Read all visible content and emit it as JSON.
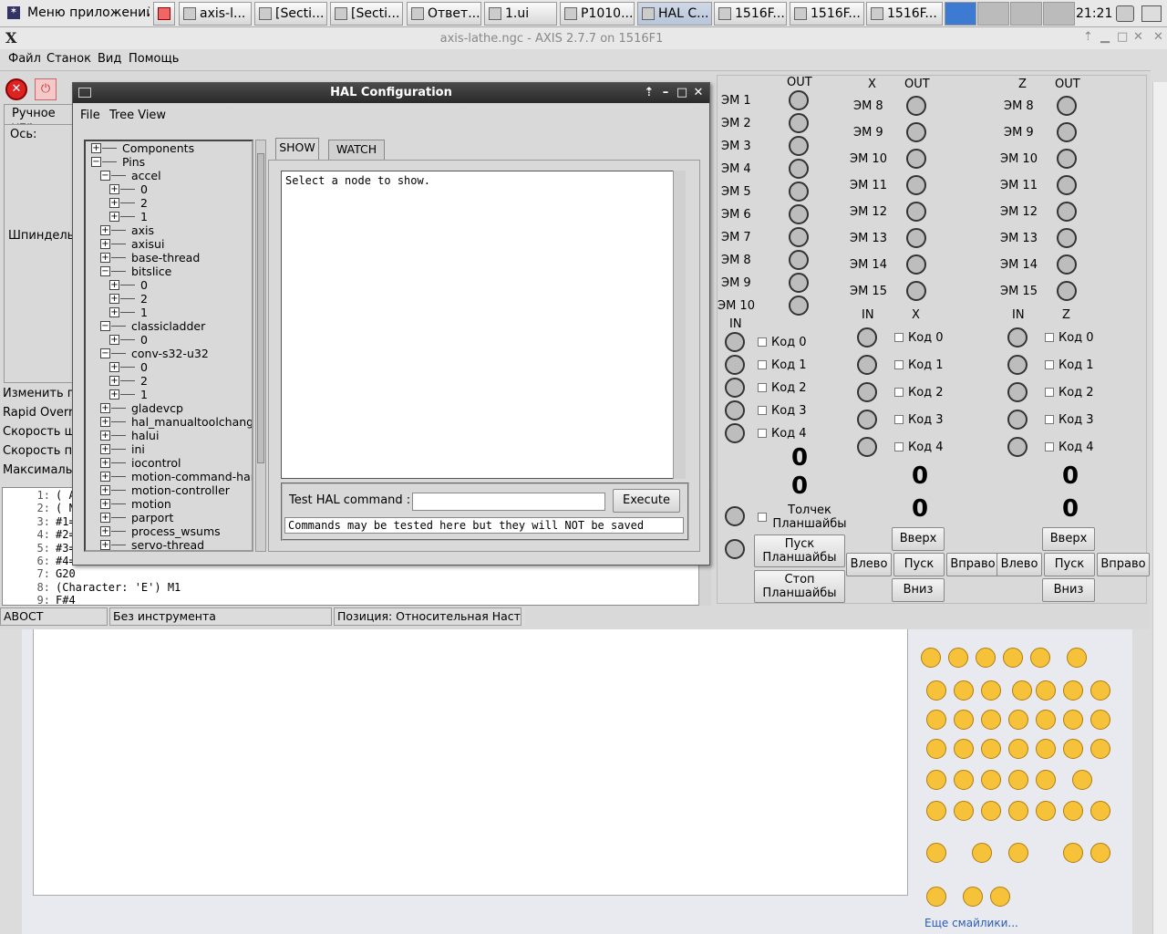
{
  "taskbar": {
    "apps_menu": "Меню приложений",
    "items": [
      "axis-l...",
      "[Secti...",
      "[Secti...",
      "Ответ...",
      "1.ui",
      "P1010...",
      "HAL C...",
      "1516F...",
      "1516F...",
      "1516F..."
    ],
    "clock": "21:21"
  },
  "axis": {
    "title": "axis-lathe.ngc - AXIS 2.7.7 on 1516F1",
    "menus": [
      "Файл",
      "Станок",
      "Вид",
      "Помощь"
    ],
    "tab_manual": "Ручное упр",
    "axis_label": "Ось:",
    "spindle_label": "Шпиндель:",
    "overrides": [
      "Изменить пе",
      "Rapid Overri",
      "Скорость ш",
      "Скорость пе",
      "Максимальн"
    ],
    "gcode": [
      {
        "n": "1:",
        "t": "( A"
      },
      {
        "n": "2:",
        "t": "( N"
      },
      {
        "n": "3:",
        "t": "#1="
      },
      {
        "n": "4:",
        "t": "#2="
      },
      {
        "n": "5:",
        "t": "#3="
      },
      {
        "n": "6:",
        "t": "#4="
      },
      {
        "n": "7:",
        "t": "G20"
      },
      {
        "n": "8:",
        "t": "(Character: 'E') M1"
      },
      {
        "n": "9:",
        "t": "F#4"
      }
    ],
    "status": [
      "АВОСТ",
      "Без инструмента",
      "Позиция: Относительная Насто"
    ]
  },
  "hal": {
    "title": "HAL Configuration",
    "menus": [
      "File",
      "Tree View"
    ],
    "tree": [
      {
        "label": "Components",
        "level": 0,
        "sign": "+"
      },
      {
        "label": "Pins",
        "level": 0,
        "sign": "-"
      },
      {
        "label": "accel",
        "level": 1,
        "sign": "-"
      },
      {
        "label": "0",
        "level": 2,
        "sign": "+"
      },
      {
        "label": "2",
        "level": 2,
        "sign": "+"
      },
      {
        "label": "1",
        "level": 2,
        "sign": "+"
      },
      {
        "label": "axis",
        "level": 1,
        "sign": "+"
      },
      {
        "label": "axisui",
        "level": 1,
        "sign": "+"
      },
      {
        "label": "base-thread",
        "level": 1,
        "sign": "+"
      },
      {
        "label": "bitslice",
        "level": 1,
        "sign": "-"
      },
      {
        "label": "0",
        "level": 2,
        "sign": "+"
      },
      {
        "label": "2",
        "level": 2,
        "sign": "+"
      },
      {
        "label": "1",
        "level": 2,
        "sign": "+"
      },
      {
        "label": "classicladder",
        "level": 1,
        "sign": "-"
      },
      {
        "label": "0",
        "level": 2,
        "sign": "+"
      },
      {
        "label": "conv-s32-u32",
        "level": 1,
        "sign": "-"
      },
      {
        "label": "0",
        "level": 2,
        "sign": "+"
      },
      {
        "label": "2",
        "level": 2,
        "sign": "+"
      },
      {
        "label": "1",
        "level": 2,
        "sign": "+"
      },
      {
        "label": "gladevcp",
        "level": 1,
        "sign": "+"
      },
      {
        "label": "hal_manualtoolchange",
        "level": 1,
        "sign": "+"
      },
      {
        "label": "halui",
        "level": 1,
        "sign": "+"
      },
      {
        "label": "ini",
        "level": 1,
        "sign": "+"
      },
      {
        "label": "iocontrol",
        "level": 1,
        "sign": "+"
      },
      {
        "label": "motion-command-har",
        "level": 1,
        "sign": "+"
      },
      {
        "label": "motion-controller",
        "level": 1,
        "sign": "+"
      },
      {
        "label": "motion",
        "level": 1,
        "sign": "+"
      },
      {
        "label": "parport",
        "level": 1,
        "sign": "+"
      },
      {
        "label": "process_wsums",
        "level": 1,
        "sign": "+"
      },
      {
        "label": "servo-thread",
        "level": 1,
        "sign": "+"
      }
    ],
    "tabs": [
      "SHOW",
      "WATCH"
    ],
    "show_text": "Select a node to show.",
    "test_label": "Test HAL command :",
    "execute": "Execute",
    "note": "Commands may be tested here but they will NOT be saved"
  },
  "panel": {
    "col1": {
      "out": "OUT",
      "ems": [
        "ЭМ 1",
        "ЭМ 2",
        "ЭМ 3",
        "ЭМ 4",
        "ЭМ 5",
        "ЭМ 6",
        "ЭМ 7",
        "ЭМ 8",
        "ЭМ 9",
        "ЭМ 10"
      ],
      "in": "IN",
      "codes": [
        "Код 0",
        "Код 1",
        "Код 2",
        "Код 3",
        "Код 4"
      ],
      "num1": "0",
      "num2": "0",
      "jog": "Толчек Планшайбы",
      "start": "Пуск Планшайбы",
      "stop": "Стоп Планшайбы"
    },
    "colX": {
      "head": "X",
      "out": "OUT",
      "ems": [
        "ЭМ 8",
        "ЭМ 9",
        "ЭМ 10",
        "ЭМ 11",
        "ЭМ 12",
        "ЭМ 13",
        "ЭМ 14",
        "ЭМ 15"
      ],
      "in": "IN",
      "axis": "X",
      "codes": [
        "Код 0",
        "Код 1",
        "Код 2",
        "Код 3",
        "Код 4"
      ],
      "num1": "0",
      "num2": "0",
      "up": "Вверх",
      "left": "Влево",
      "start": "Пуск",
      "right": "Вправо",
      "down": "Вниз"
    },
    "colZ": {
      "head": "Z",
      "out": "OUT",
      "ems": [
        "ЭМ 8",
        "ЭМ 9",
        "ЭМ 10",
        "ЭМ 11",
        "ЭМ 12",
        "ЭМ 13",
        "ЭМ 14",
        "ЭМ 15"
      ],
      "in": "IN",
      "axis": "Z",
      "codes": [
        "Код 0",
        "Код 1",
        "Код 2",
        "Код 3",
        "Код 4"
      ],
      "num1": "0",
      "num2": "0",
      "up": "Вверх",
      "left": "Влево",
      "start": "Пуск",
      "right": "Вправо",
      "down": "Вниз"
    }
  },
  "web": {
    "more_smileys": "Еще смайлики..."
  }
}
